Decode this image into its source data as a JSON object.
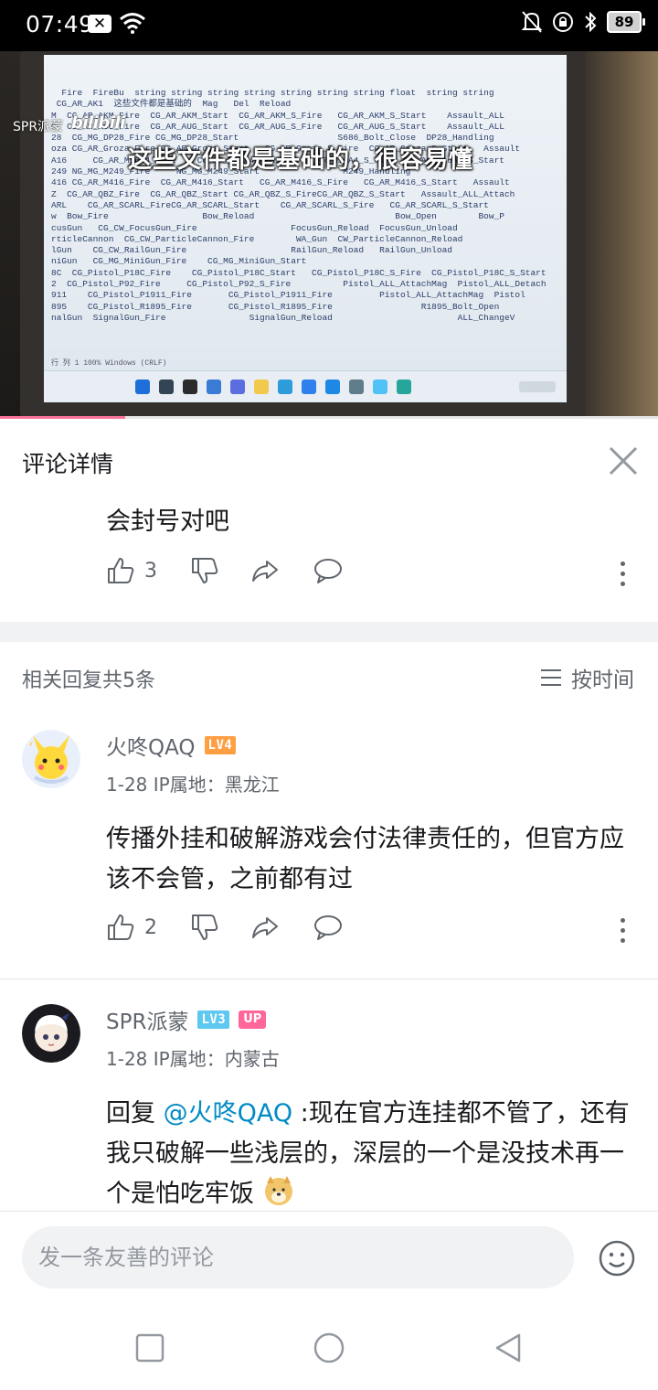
{
  "status_bar": {
    "time": "07:49",
    "battery": "89",
    "icons": [
      "x-notification-icon",
      "wifi-icon",
      "bell-muted-icon",
      "lock-rotation-icon",
      "bluetooth-icon"
    ]
  },
  "video": {
    "uploader_tag": "SPR派蒙",
    "logo": "bilibili",
    "subtitle": "这些文件都是基础的，很容易懂",
    "progress": 0.19,
    "screen_lines": [
      "  Fire  FireBu  string string string string string string string float  string string",
      " CG_AR_AK1  这些文件都是基础的  Mag   Del  Reload",
      "M  CG_AR_AKM_Fire  CG_AR_AKM_Start  CG_AR_AKM_S_Fire   CG_AR_AKM_S_Start    Assault_ALL",
      "G  CG_AR_AUG_Fire  CG_AR_AUG_Start  CG_AR_AUG_S_Fire   CG_AR_AUG_S_Start    Assault_ALL",
      "28  CG_MG_DP28_Fire CG_MG_DP28_Start                   S686_Bolt_Close  DP28_Handling",
      "oza CG_AR_Groza_Fire CG_AR_Groza_Start   CG_AR_Groza_S_Fire  CG_AR_Groza_S_Start   Assault",
      "A16     CG_AR_M16A4_Fire    CG_AR_M16A4_Start   CG_AR_M16A4_S_Fire  CG_AR_M16A4_S_Start",
      "249 NG_MG_M249_Fire     NG_MG_M249_Start                M249_Handling",
      "416 CG_AR_M416_Fire  CG_AR_M416_Start   CG_AR_M416_S_Fire   CG_AR_M416_S_Start   Assault",
      "Z  CG_AR_QBZ_Fire  CG_AR_QBZ_Start CG_AR_QBZ_S_FireCG_AR_QBZ_S_Start   Assault_ALL_Attach",
      "ARL    CG_AR_SCARL_FireCG_AR_SCARL_Start    CG_AR_SCARL_S_Fire   CG_AR_SCARL_S_Start",
      "w  Bow_Fire                  Bow_Reload                           Bow_Open        Bow_P",
      "cusGun   CG_CW_FocusGun_Fire                  FocusGun_Reload  FocusGun_Unload",
      "rticleCannon  CG_CW_ParticleCannon_Fire        WA_Gun  CW_ParticleCannon_Reload",
      "lGun    CG_CW_RailGun_Fire                    RailGun_Reload   RailGun_Unload",
      "niGun   CG_MG_MiniGun_Fire    CG_MG_MiniGun_Start",
      "8C  CG_Pistol_P18C_Fire    CG_Pistol_P18C_Start   CG_Pistol_P18C_S_Fire  CG_Pistol_P18C_S_Start",
      "2  CG_Pistol_P92_Fire     CG_Pistol_P92_S_Fire          Pistol_ALL_AttachMag  Pistol_ALL_Detach",
      "911    CG_Pistol_P1911_Fire       CG_Pistol_P1911_Fire         Pistol_ALL_AttachMag  Pistol",
      "895    CG_Pistol_R1895_Fire       CG_Pistol_R1895_Fire                 R1895_Bolt_Open",
      "nalGun  SignalGun_Fire                SignalGun_Reload                        ALL_ChangeV"
    ]
  },
  "header": {
    "title": "评论详情"
  },
  "root_comment": {
    "text": "会封号对吧",
    "likes": "3"
  },
  "replies": {
    "count_label": "相关回复共5条",
    "sort_label": "按时间",
    "items": [
      {
        "username": "火咚QAQ",
        "level": "LV4",
        "level_color": "#ff9f43",
        "date": "1-28",
        "ip": "IP属地：黑龙江",
        "text": "传播外挂和破解游戏会付法律责任的，但官方应该不会管，之前都有过",
        "likes": "2"
      },
      {
        "username": "SPR派蒙",
        "level": "LV3",
        "level_color": "#5ec8f0",
        "badge": "UP",
        "date": "1-28",
        "ip": "IP属地：内蒙古",
        "reply_prefix": "回复 ",
        "mention": "@火咚QAQ",
        "text": " :现在官方连挂都不管了，还有我只破解一些浅层的，深层的一个是没技术再一个是怕吃牢饭"
      }
    ]
  },
  "composer": {
    "placeholder": "发一条友善的评论"
  },
  "colors": {
    "brand_pink": "#fb7299",
    "link_blue": "#008ac5",
    "text_primary": "#18191c",
    "text_secondary": "#61666d"
  }
}
